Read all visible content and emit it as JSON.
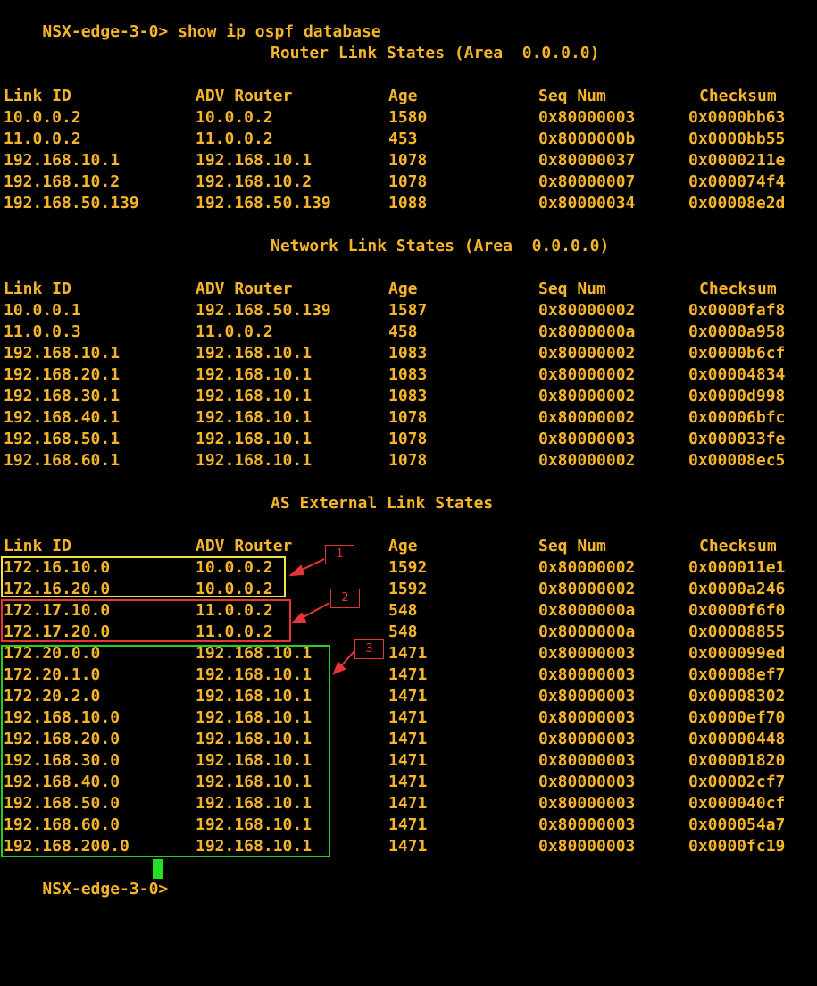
{
  "prompt": "NSX-edge-3-0>",
  "command": "show ip ospf database",
  "columns": [
    "Link ID",
    "ADV Router",
    "Age",
    "Seq Num",
    "Checksum"
  ],
  "sections": [
    {
      "title": "Router Link States (Area  0.0.0.0)",
      "rows": [
        [
          "10.0.0.2",
          "10.0.0.2",
          "1580",
          "0x80000003",
          "0x0000bb63"
        ],
        [
          "11.0.0.2",
          "11.0.0.2",
          "453",
          "0x8000000b",
          "0x0000bb55"
        ],
        [
          "192.168.10.1",
          "192.168.10.1",
          "1078",
          "0x80000037",
          "0x0000211e"
        ],
        [
          "192.168.10.2",
          "192.168.10.2",
          "1078",
          "0x80000007",
          "0x000074f4"
        ],
        [
          "192.168.50.139",
          "192.168.50.139",
          "1088",
          "0x80000034",
          "0x00008e2d"
        ]
      ]
    },
    {
      "title": "Network Link States (Area  0.0.0.0)",
      "rows": [
        [
          "10.0.0.1",
          "192.168.50.139",
          "1587",
          "0x80000002",
          "0x0000faf8"
        ],
        [
          "11.0.0.3",
          "11.0.0.2",
          "458",
          "0x8000000a",
          "0x0000a958"
        ],
        [
          "192.168.10.1",
          "192.168.10.1",
          "1083",
          "0x80000002",
          "0x0000b6cf"
        ],
        [
          "192.168.20.1",
          "192.168.10.1",
          "1083",
          "0x80000002",
          "0x00004834"
        ],
        [
          "192.168.30.1",
          "192.168.10.1",
          "1083",
          "0x80000002",
          "0x0000d998"
        ],
        [
          "192.168.40.1",
          "192.168.10.1",
          "1078",
          "0x80000002",
          "0x00006bfc"
        ],
        [
          "192.168.50.1",
          "192.168.10.1",
          "1078",
          "0x80000003",
          "0x000033fe"
        ],
        [
          "192.168.60.1",
          "192.168.10.1",
          "1078",
          "0x80000002",
          "0x00008ec5"
        ]
      ]
    },
    {
      "title": "AS External Link States",
      "rows": [
        [
          "172.16.10.0",
          "10.0.0.2",
          "1592",
          "0x80000002",
          "0x000011e1"
        ],
        [
          "172.16.20.0",
          "10.0.0.2",
          "1592",
          "0x80000002",
          "0x0000a246"
        ],
        [
          "172.17.10.0",
          "11.0.0.2",
          "548",
          "0x8000000a",
          "0x0000f6f0"
        ],
        [
          "172.17.20.0",
          "11.0.0.2",
          "548",
          "0x8000000a",
          "0x00008855"
        ],
        [
          "172.20.0.0",
          "192.168.10.1",
          "1471",
          "0x80000003",
          "0x000099ed"
        ],
        [
          "172.20.1.0",
          "192.168.10.1",
          "1471",
          "0x80000003",
          "0x00008ef7"
        ],
        [
          "172.20.2.0",
          "192.168.10.1",
          "1471",
          "0x80000003",
          "0x00008302"
        ],
        [
          "192.168.10.0",
          "192.168.10.1",
          "1471",
          "0x80000003",
          "0x0000ef70"
        ],
        [
          "192.168.20.0",
          "192.168.10.1",
          "1471",
          "0x80000003",
          "0x00000448"
        ],
        [
          "192.168.30.0",
          "192.168.10.1",
          "1471",
          "0x80000003",
          "0x00001820"
        ],
        [
          "192.168.40.0",
          "192.168.10.1",
          "1471",
          "0x80000003",
          "0x00002cf7"
        ],
        [
          "192.168.50.0",
          "192.168.10.1",
          "1471",
          "0x80000003",
          "0x000040cf"
        ],
        [
          "192.168.60.0",
          "192.168.10.1",
          "1471",
          "0x80000003",
          "0x000054a7"
        ],
        [
          "192.168.200.0",
          "192.168.10.1",
          "1471",
          "0x80000003",
          "0x0000fc19"
        ]
      ]
    }
  ],
  "annotations": [
    {
      "label": "1",
      "color": "#f2e04a"
    },
    {
      "label": "2",
      "color": "#e53535"
    },
    {
      "label": "3",
      "color": "#22d022"
    }
  ],
  "colors": {
    "background": "#000000",
    "text": "#f5b52a",
    "cursor": "#22e022",
    "arrow": "#e53535"
  }
}
